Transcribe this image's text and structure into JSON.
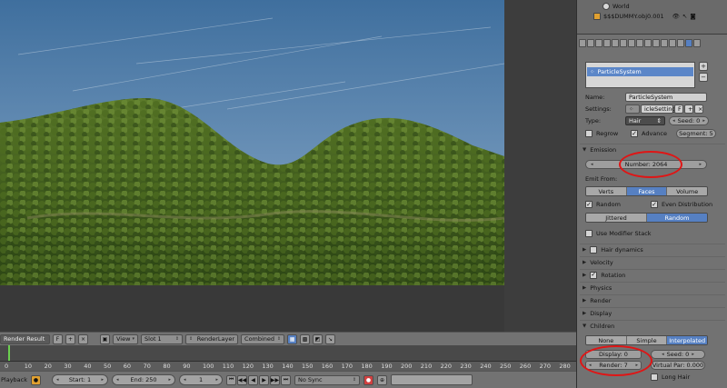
{
  "outliner": {
    "items": [
      "World",
      "$$$DUMMY.obj0.001"
    ]
  },
  "particle_system": {
    "list_item": "ParticleSystem",
    "name_label": "Name:",
    "name_value": "ParticleSystem",
    "settings_label": "Settings:",
    "settings_value": "icleSettings",
    "settings_f": "F",
    "type_label": "Type:",
    "type_value": "Hair",
    "seed": "Seed: 0",
    "regrow": "Regrow",
    "advance": "Advance",
    "segments": "Segment: 5"
  },
  "emission": {
    "header": "Emission",
    "number": "Number: 2064",
    "emit_from": "Emit From:",
    "emit_options": [
      "Verts",
      "Faces",
      "Volume"
    ],
    "emit_active": "Faces",
    "random": "Random",
    "even_distribution": "Even Distribution",
    "distribution_options": [
      "Jittered",
      "Random"
    ],
    "distribution_active": "Random",
    "use_modifier_stack": "Use Modifier Stack"
  },
  "sections": [
    "Hair dynamics",
    "Velocity",
    "Rotation",
    "Physics",
    "Render",
    "Display",
    "Children"
  ],
  "children": {
    "options": [
      "None",
      "Simple",
      "Interpolated"
    ],
    "active": "Interpolated",
    "display": "Display: 0",
    "seed": "Seed: 0",
    "render": "Render: 7",
    "virtual_parents": "Virtual Par: 0.000",
    "long_hair": "Long Hair"
  },
  "image_header": {
    "image_name": "Render Result",
    "f_label": "F",
    "view": "View",
    "slot": "Slot 1",
    "layer": "RenderLayer",
    "pass": "Combined"
  },
  "timeline": {
    "ticks": [
      "0",
      "10",
      "20",
      "30",
      "40",
      "50",
      "60",
      "70",
      "80",
      "90",
      "100",
      "110",
      "120",
      "130",
      "140",
      "150",
      "160",
      "170",
      "180",
      "190",
      "200",
      "210",
      "220",
      "230",
      "240",
      "250",
      "260",
      "270",
      "280"
    ]
  },
  "playback": {
    "playback_label": "Playback",
    "start": "Start: 1",
    "end": "End: 250",
    "current_frame": "1",
    "sync": "No Sync"
  },
  "colors": {
    "accent_blue": "#5680c2",
    "highlight_red": "#e01515",
    "timeline_cursor": "#6bd04f"
  }
}
